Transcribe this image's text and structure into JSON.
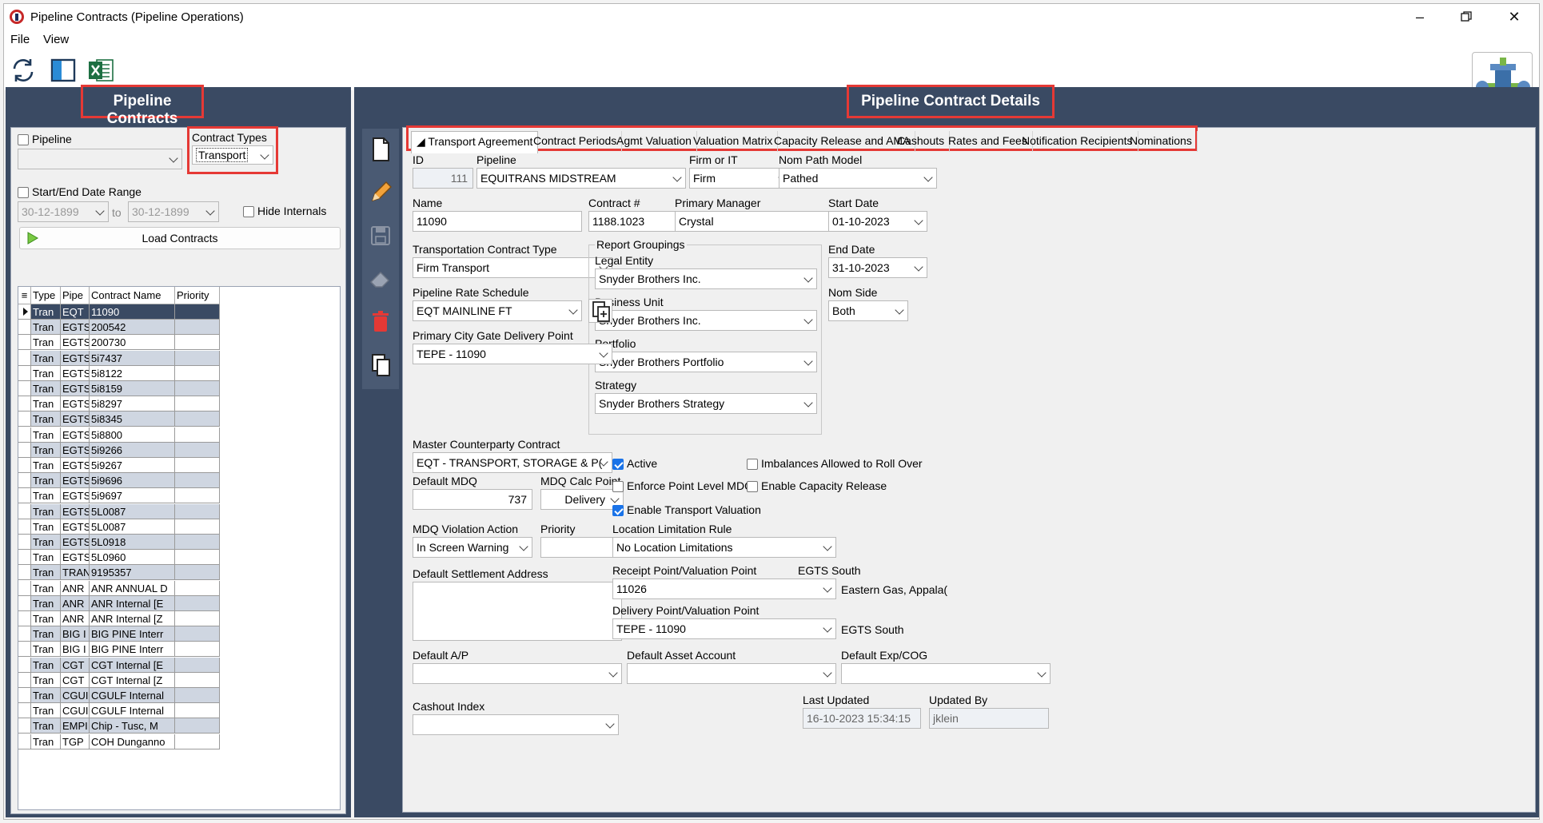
{
  "window": {
    "title": "Pipeline Contracts (Pipeline Operations)"
  },
  "menu": {
    "file": "File",
    "view": "View"
  },
  "left": {
    "title": "Pipeline Contracts",
    "pipeline_label": "Pipeline",
    "contract_types_label": "Contract Types",
    "contract_type_value": "Transport",
    "date_range_label": "Start/End Date Range",
    "start_date": "30-12-1899",
    "to_label": "to",
    "end_date": "30-12-1899",
    "hide_internals_label": "Hide Internals",
    "load_button": "Load Contracts",
    "columns": [
      "Type",
      "Pipe",
      "Contract Name",
      "Priority"
    ],
    "rows": [
      [
        "Tran",
        "EQT",
        "11090",
        ""
      ],
      [
        "Tran",
        "EGTS",
        "200542",
        ""
      ],
      [
        "Tran",
        "EGTS",
        "200730",
        ""
      ],
      [
        "Tran",
        "EGTS",
        "5i7437",
        ""
      ],
      [
        "Tran",
        "EGTS",
        "5i8122",
        ""
      ],
      [
        "Tran",
        "EGTS",
        "5i8159",
        ""
      ],
      [
        "Tran",
        "EGTS",
        "5i8297",
        ""
      ],
      [
        "Tran",
        "EGTS",
        "5i8345",
        ""
      ],
      [
        "Tran",
        "EGTS",
        "5i8800",
        ""
      ],
      [
        "Tran",
        "EGTS",
        "5i9266",
        ""
      ],
      [
        "Tran",
        "EGTS",
        "5i9267",
        ""
      ],
      [
        "Tran",
        "EGTS",
        "5i9696",
        ""
      ],
      [
        "Tran",
        "EGTS",
        "5i9697",
        ""
      ],
      [
        "Tran",
        "EGTS",
        "5L0087",
        ""
      ],
      [
        "Tran",
        "EGTS",
        "5L0087",
        ""
      ],
      [
        "Tran",
        "EGTS",
        "5L0918",
        ""
      ],
      [
        "Tran",
        "EGTS",
        "5L0960",
        ""
      ],
      [
        "Tran",
        "TRAN",
        "9195357",
        ""
      ],
      [
        "Tran",
        "ANR",
        "ANR ANNUAL D",
        ""
      ],
      [
        "Tran",
        "ANR",
        "ANR Internal [E",
        ""
      ],
      [
        "Tran",
        "ANR",
        "ANR Internal [Z",
        ""
      ],
      [
        "Tran",
        "BIG I",
        "BIG PINE Interr",
        ""
      ],
      [
        "Tran",
        "BIG I",
        "BIG PINE Interr",
        ""
      ],
      [
        "Tran",
        "CGT",
        "CGT Internal [E",
        ""
      ],
      [
        "Tran",
        "CGT",
        "CGT Internal [Z",
        ""
      ],
      [
        "Tran",
        "CGUI",
        "CGULF Internal",
        ""
      ],
      [
        "Tran",
        "CGUI",
        "CGULF Internal",
        ""
      ],
      [
        "Tran",
        "EMPI",
        "Chip - Tusc, M",
        ""
      ],
      [
        "Tran",
        "TGP",
        "COH Dunganno",
        ""
      ]
    ]
  },
  "right": {
    "title": "Pipeline Contract Details",
    "tabs": [
      "Transport Agreement",
      "Contract Periods",
      "Agmt Valuation",
      "Valuation Matrix",
      "Capacity Release and AMA",
      "Cashouts",
      "Rates and Fees",
      "Notification Recipients",
      "Nominations"
    ],
    "fields": {
      "id_label": "ID",
      "id_value": "111",
      "pipeline_label": "Pipeline",
      "pipeline_value": "EQUITRANS MIDSTREAM",
      "firm_label": "Firm or IT",
      "firm_value": "Firm",
      "nom_path_label": "Nom Path Model",
      "nom_path_value": "Pathed",
      "name_label": "Name",
      "name_value": "11090",
      "contract_no_label": "Contract #",
      "contract_no_value": "1188.1023",
      "manager_label": "Primary Manager",
      "manager_value": "Crystal",
      "start_label": "Start Date",
      "start_value": "01-10-2023",
      "tct_label": "Transportation Contract Type",
      "tct_value": "Firm Transport",
      "report_groupings_label": "Report Groupings",
      "legal_entity_label": "Legal Entity",
      "legal_entity_value": "Snyder Brothers Inc.",
      "business_unit_label": "Business Unit",
      "business_unit_value": "Snyder Brothers Inc.",
      "portfolio_label": "Portfolio",
      "portfolio_value": "Snyder Brothers Portfolio",
      "strategy_label": "Strategy",
      "strategy_value": "Snyder Brothers Strategy",
      "end_label": "End Date",
      "end_value": "31-10-2023",
      "rate_label": "Pipeline Rate Schedule",
      "rate_value": "EQT MAINLINE FT",
      "nom_side_label": "Nom Side",
      "nom_side_value": "Both",
      "city_gate_label": "Primary City Gate Delivery Point",
      "city_gate_value": "TEPE - 11090",
      "master_label": "Master Counterparty Contract",
      "master_value": "EQT - TRANSPORT, STORAGE & P(",
      "active_label": "Active",
      "imbalances_label": "Imbalances Allowed to Roll Over",
      "mdq_label": "Default MDQ",
      "mdq_value": "737",
      "mdq_calc_label": "MDQ Calc Point",
      "mdq_calc_value": "Delivery",
      "enforce_label": "Enforce Point Level MDQ",
      "capacity_label": "Enable Capacity Release",
      "transport_val_label": "Enable Transport Valuation",
      "violation_label": "MDQ Violation Action",
      "violation_value": "In Screen Warning",
      "priority_label": "Priority",
      "location_label": "Location Limitation Rule",
      "location_value": "No Location Limitations",
      "settlement_label": "Default Settlement Address",
      "receipt_label": "Receipt Point/Valuation Point",
      "receipt_pipe": "EGTS South",
      "receipt_value": "11026",
      "receipt_desc": "Eastern Gas, Appala(",
      "delivery_label": "Delivery Point/Valuation Point",
      "delivery_value": "TEPE - 11090",
      "delivery_pipe": "EGTS South",
      "ap_label": "Default A/P",
      "asset_label": "Default Asset Account",
      "exp_label": "Default Exp/COG",
      "cashout_label": "Cashout Index",
      "last_updated_label": "Last Updated",
      "last_updated_value": "16-10-2023 15:34:15",
      "updated_by_label": "Updated By",
      "updated_by_value": "jklein"
    }
  }
}
